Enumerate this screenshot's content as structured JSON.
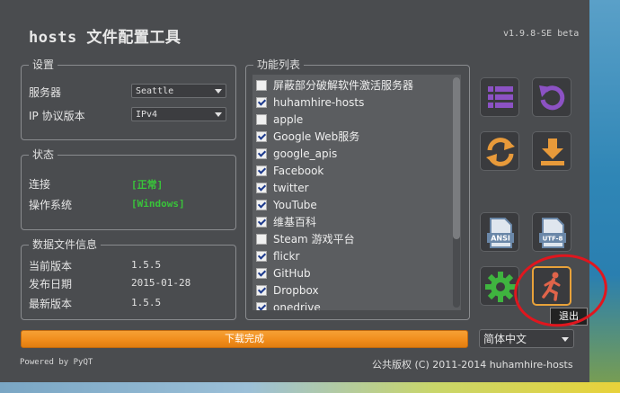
{
  "app": {
    "title": "hosts 文件配置工具",
    "version": "v1.9.8-SE beta"
  },
  "settings": {
    "group_title": "设置",
    "server_label": "服务器",
    "server_value": "Seattle",
    "ip_label": "IP 协议版本",
    "ip_value": "IPv4"
  },
  "status": {
    "group_title": "状态",
    "connection_label": "连接",
    "connection_value": "[正常]",
    "os_label": "操作系统",
    "os_value": "[Windows]"
  },
  "datafile": {
    "group_title": "数据文件信息",
    "current_label": "当前版本",
    "current_value": "1.5.5",
    "release_label": "发布日期",
    "release_value": "2015-01-28",
    "latest_label": "最新版本",
    "latest_value": "1.5.5"
  },
  "functions": {
    "group_title": "功能列表",
    "items": [
      {
        "label": "屏蔽部分破解软件激活服务器",
        "checked": false
      },
      {
        "label": "huhamhire-hosts",
        "checked": true
      },
      {
        "label": "apple",
        "checked": false
      },
      {
        "label": "Google Web服务",
        "checked": true
      },
      {
        "label": "google_apis",
        "checked": true
      },
      {
        "label": "Facebook",
        "checked": true
      },
      {
        "label": "twitter",
        "checked": true
      },
      {
        "label": "YouTube",
        "checked": true
      },
      {
        "label": "维基百科",
        "checked": true
      },
      {
        "label": "Steam 游戏平台",
        "checked": false
      },
      {
        "label": "flickr",
        "checked": true
      },
      {
        "label": "GitHub",
        "checked": true
      },
      {
        "label": "Dropbox",
        "checked": true
      },
      {
        "label": "onedrive",
        "checked": true
      }
    ]
  },
  "buttons": {
    "ansi_label": "ANSI",
    "utf8_label": "UTF-8",
    "exit_tooltip": "退出"
  },
  "progress": {
    "label": "下载完成",
    "percent": 100
  },
  "language": {
    "selected": "简体中文"
  },
  "footer": {
    "powered": "Powered by PyQT",
    "copyright": "公共版权 (C) 2011-2014 huhamhire-hosts"
  },
  "colors": {
    "accent": "#f08c1a",
    "icon_purple": "#8c52c4",
    "icon_orange": "#e89a3a",
    "icon_green": "#3fb43f",
    "status_green": "#39c43a",
    "annotation_red": "#e0161e"
  }
}
